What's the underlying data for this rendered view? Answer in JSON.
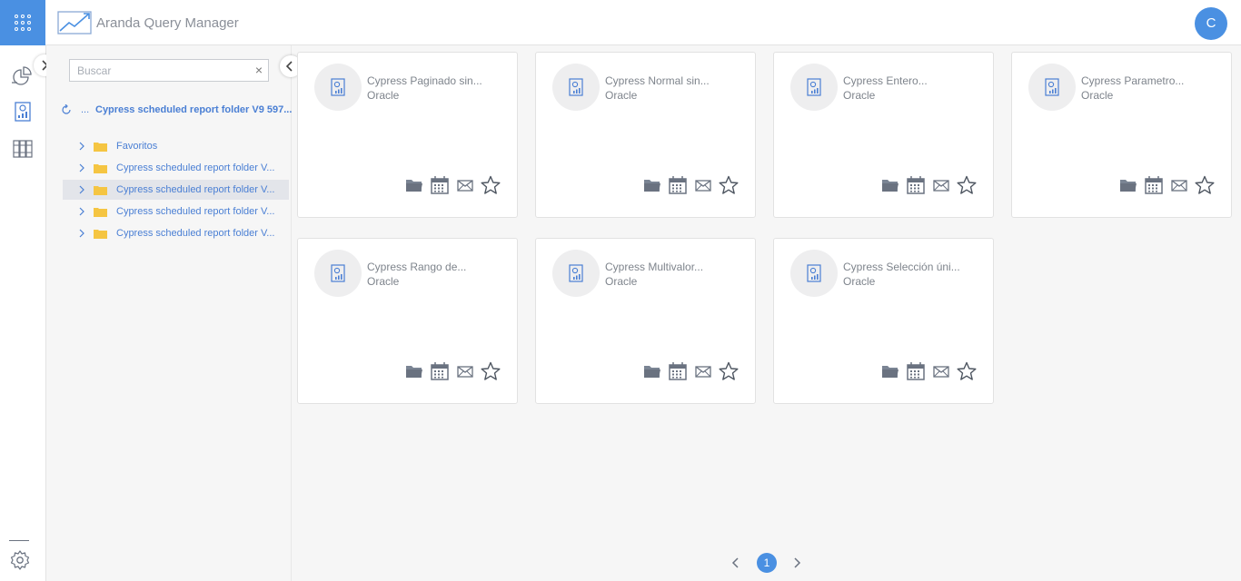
{
  "header": {
    "apps_icon": "grid-icon",
    "logo_icon": "trend-chart-icon",
    "title": "Aranda Query Manager",
    "user_initial": "C",
    "accent_color": "#4a90e2"
  },
  "rail": {
    "items": [
      {
        "icon": "pie-chart-icon"
      },
      {
        "icon": "report-document-icon"
      },
      {
        "icon": "binders-icon"
      }
    ],
    "settings_icon": "gear-icon"
  },
  "tree": {
    "search": {
      "placeholder": "Buscar",
      "value": "",
      "clear_glyph": "×"
    },
    "root": {
      "ellipsis": "...",
      "label": "Cypress scheduled report folder V9 597..."
    },
    "items": [
      {
        "label": "Favoritos",
        "selected": false
      },
      {
        "label": "Cypress scheduled report folder V...",
        "selected": false
      },
      {
        "label": "Cypress scheduled report folder V...",
        "selected": true
      },
      {
        "label": "Cypress scheduled report folder V...",
        "selected": false
      },
      {
        "label": "Cypress scheduled report folder V...",
        "selected": false
      }
    ]
  },
  "cards": [
    {
      "title": "Cypress Paginado sin...",
      "subtitle": "Oracle"
    },
    {
      "title": "Cypress Normal sin...",
      "subtitle": "Oracle"
    },
    {
      "title": "Cypress Entero...",
      "subtitle": "Oracle"
    },
    {
      "title": "Cypress Parametro...",
      "subtitle": "Oracle"
    },
    {
      "title": "Cypress Rango de...",
      "subtitle": "Oracle"
    },
    {
      "title": "Cypress Multivalor...",
      "subtitle": "Oracle"
    },
    {
      "title": "Cypress Selección úni...",
      "subtitle": "Oracle"
    }
  ],
  "pagination": {
    "current": "1",
    "prev_icon": "chevron-left-icon",
    "next_icon": "chevron-right-icon"
  }
}
